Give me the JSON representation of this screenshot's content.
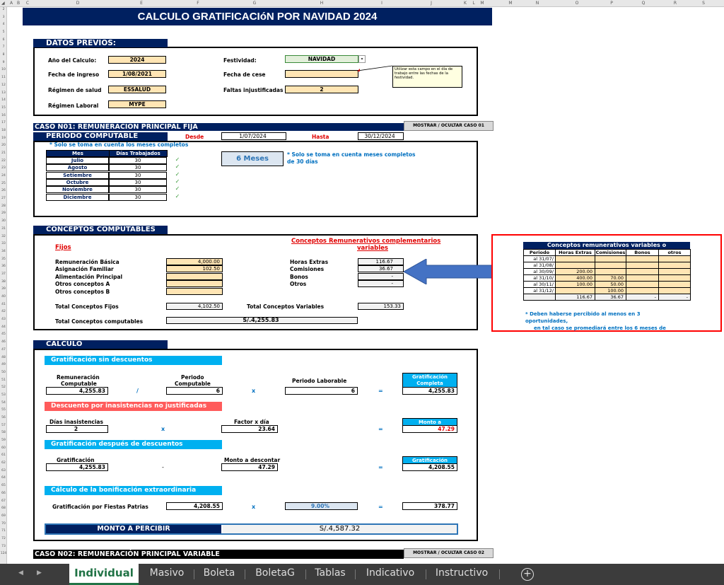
{
  "title": "CALCULO GRATIFICACIóN POR NAVIDAD 2024",
  "col_headers": [
    "A",
    "B",
    "C",
    "D",
    "E",
    "F",
    "G",
    "H",
    "I",
    "J",
    "K",
    "L",
    "M",
    "N",
    "O",
    "P",
    "Q",
    "R",
    "S"
  ],
  "row_headers": [
    "2",
    "3",
    "4",
    "5",
    "6",
    "7",
    "8",
    "9",
    "10",
    "11",
    "12",
    "13",
    "14",
    "15",
    "16",
    "17",
    "18",
    "19",
    "20",
    "21",
    "22",
    "23",
    "24",
    "25",
    "26",
    "27",
    "28",
    "29",
    "30",
    "31",
    "32",
    "33",
    "34",
    "35",
    "36",
    "37",
    "38",
    "39",
    "40",
    "41",
    "42",
    "43",
    "44",
    "45",
    "46",
    "47",
    "48",
    "49",
    "50",
    "51",
    "52",
    "53",
    "54",
    "55",
    "56",
    "57",
    "58",
    "59",
    "60",
    "61",
    "62",
    "63",
    "64",
    "65",
    "66",
    "67",
    "68",
    "69",
    "70",
    "71",
    "72",
    "73",
    "124"
  ],
  "datos_previos": {
    "header": "DATOS PREVIOS:",
    "anio_label": "Año del Calculo:",
    "anio_value": "2024",
    "ingreso_label": "Fecha de ingreso",
    "ingreso_value": "1/08/2021",
    "salud_label": "Régimen de salud",
    "salud_value": "ESSALUD",
    "laboral_label": "Régimen Laboral",
    "laboral_value": "MYPE",
    "festividad_label": "Festividad:",
    "festividad_value": "NAVIDAD",
    "cese_label": "Fecha de cese",
    "cese_value": "",
    "faltas_label": "Faltas injustificadas",
    "faltas_value": "2",
    "comment": "Utilizar esta campo en el día de trabajo entre las fechas de la festividad."
  },
  "caso1": {
    "header": "CASO N01: REMUNERACIÓN PRINCIPAL FIJA",
    "toggle": "MOSTRAR / OCULTAR CASO 01",
    "periodo_label": "PERIODO COMPUTABLE",
    "desde_label": "Desde",
    "desde_value": "1/07/2024",
    "hasta_label": "Hasta",
    "hasta_value": "30/12/2024",
    "note1": "* Solo se toma en cuenta los meses completos",
    "mes_col": "Mes",
    "dias_col": "Días Trabajados",
    "meses": [
      {
        "mes": "Julio",
        "dias": "30",
        "ok": "✓"
      },
      {
        "mes": "Agosto",
        "dias": "30",
        "ok": "✓"
      },
      {
        "mes": "Setiembre",
        "dias": "30",
        "ok": "✓"
      },
      {
        "mes": "Octubre",
        "dias": "30",
        "ok": "✓"
      },
      {
        "mes": "Noviembre",
        "dias": "30",
        "ok": "✓"
      },
      {
        "mes": "Diciembre",
        "dias": "30",
        "ok": "✓"
      }
    ],
    "meses_total": "6 Meses",
    "note2a": "* Solo se toma en cuenta meses completos",
    "note2b": "de 30 días"
  },
  "conceptos": {
    "header": "CONCEPTOS COMPUTABLES",
    "fijos_label": "Fijos",
    "var_label_a": "Conceptos Remunerativos complementarios",
    "var_label_b": "variables",
    "fijos": [
      {
        "label": "Remuneración Básica",
        "value": "4,000.00"
      },
      {
        "label": "Asignación Familiar",
        "value": "102.50"
      },
      {
        "label": "Alimentación Principal",
        "value": ""
      },
      {
        "label": "Otros conceptos A",
        "value": ""
      },
      {
        "label": "Otros conceptos B",
        "value": ""
      }
    ],
    "variables": [
      {
        "label": "Horas Extras",
        "value": "116.67"
      },
      {
        "label": "Comisiones",
        "value": "36.67"
      },
      {
        "label": "Bonos",
        "value": "-"
      },
      {
        "label": "Otros",
        "value": "-"
      }
    ],
    "total_fijos_label": "Total Conceptos Fijos",
    "total_fijos_value": "4,102.50",
    "total_var_label": "Total Conceptos Variables",
    "total_var_value": "153.33",
    "total_comp_label": "Total Conceptos computables",
    "total_comp_value": "S/.4,255.83"
  },
  "variables_panel": {
    "header": "Conceptos remunerativos variables o",
    "cols": [
      "Periodo",
      "Horas Extras",
      "Comisiones",
      "Bonos",
      "otros"
    ],
    "rows": [
      [
        "al 31/07/",
        "",
        "",
        "",
        ""
      ],
      [
        "al 31/08/",
        "",
        "",
        "",
        ""
      ],
      [
        "al 30/09/",
        "200.00",
        "",
        "",
        ""
      ],
      [
        "al 31/10/",
        "400.00",
        "70.00",
        "",
        ""
      ],
      [
        "al 30/11/",
        "100.00",
        "50.00",
        "",
        ""
      ],
      [
        "al 31/12/",
        "",
        "100.00",
        "",
        ""
      ]
    ],
    "totals": [
      "",
      "116.67",
      "36.67",
      "-",
      "-"
    ],
    "note_a": "* Deben haberse percibido al menos en 3",
    "note_b": "oportunidades,",
    "note_c": "en tal caso se promediará entre los 6 meses de"
  },
  "calculo": {
    "header": "CALCULO",
    "sec1": "Gratificación sin descuentos",
    "rem_comp_a": "Remuneración",
    "rem_comp_b": "Computable",
    "rem_comp_value": "4,255.83",
    "div_op": "/",
    "periodo_comp_a": "Periodo",
    "periodo_comp_b": "Computable",
    "periodo_comp_value": "6",
    "x_op": "x",
    "periodo_lab_label": "Periodo Laborable",
    "periodo_lab_value": "6",
    "eq_op": "=",
    "grat_comp_a": "Gratificación",
    "grat_comp_b": "Completa",
    "grat_comp_value": "4,255.83",
    "sec2": "Descuento por inasistencias no justificadas",
    "dias_inas_label": "Días inasistencias",
    "dias_inas_value": "2",
    "factor_label": "Factor x día",
    "factor_value": "23.64",
    "monto_a_label": "Monto a",
    "monto_a_value": "47.29",
    "sec3": "Gratificación después de descuentos",
    "grat_label": "Gratificación",
    "grat_value": "4,255.83",
    "minus_op": "-",
    "monto_desc_label": "Monto a descontar",
    "monto_desc_value": "47.29",
    "grat_res_label": "Gratificación",
    "grat_res_value": "4,208.55",
    "sec4": "Cálculo de la bonificación extraordinaria",
    "fiestas_label": "Gratificación por Fiestas Patrias",
    "fiestas_value": "4,208.55",
    "pct_value": "9.00%",
    "bono_value": "378.77",
    "monto_label": "MONTO A PERCIBIR",
    "monto_value": "S/.4,587.32"
  },
  "caso2": {
    "header": "CASO N02: REMUNERACIÓN PRINCIPAL VARIABLE",
    "toggle": "MOSTRAR / OCULTAR CASO 02"
  },
  "sheet_tabs": [
    "Individual",
    "Masivo",
    "Boleta",
    "BoletaG",
    "Tablas",
    "Indicativo",
    "Instructivo"
  ],
  "active_tab": "Individual",
  "colors": {
    "navy": "#002060",
    "cyan": "#00b0f0",
    "red": "#e00000",
    "input": "#ffe5b4",
    "panel_border": "#ff0000",
    "arrow": "#4472c4"
  }
}
